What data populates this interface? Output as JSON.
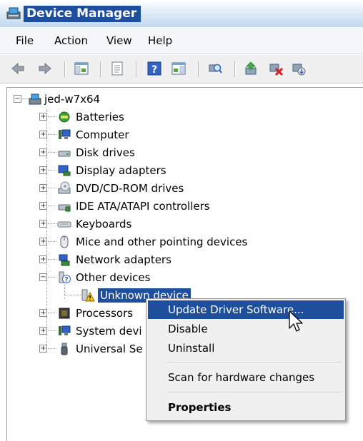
{
  "window": {
    "title": "Device Manager"
  },
  "menu": [
    "File",
    "Action",
    "View",
    "Help"
  ],
  "toolbar": {
    "icons": [
      "back-icon",
      "forward-icon",
      "show-hide-console-tree-icon",
      "properties-icon",
      "help-icon",
      "action-pane-icon",
      "scan-hardware-icon",
      "update-driver-icon",
      "uninstall-icon",
      "disable-icon"
    ]
  },
  "tree": {
    "root": "jed-w7x64",
    "categories": [
      {
        "label": "Batteries",
        "icon": "battery-icon"
      },
      {
        "label": "Computer",
        "icon": "computer-icon"
      },
      {
        "label": "Disk drives",
        "icon": "disk-drive-icon"
      },
      {
        "label": "Display adapters",
        "icon": "display-adapter-icon"
      },
      {
        "label": "DVD/CD-ROM drives",
        "icon": "dvd-drive-icon"
      },
      {
        "label": "IDE ATA/ATAPI controllers",
        "icon": "ide-controller-icon"
      },
      {
        "label": "Keyboards",
        "icon": "keyboard-icon"
      },
      {
        "label": "Mice and other pointing devices",
        "icon": "mouse-icon"
      },
      {
        "label": "Network adapters",
        "icon": "network-adapter-icon"
      },
      {
        "label": "Other devices",
        "icon": "other-devices-icon"
      }
    ],
    "other_child": "Unknown device",
    "after_categories": [
      {
        "label": "Processors",
        "icon": "processor-icon"
      },
      {
        "label": "System devi",
        "icon": "system-devices-icon"
      },
      {
        "label": "Universal Se",
        "icon": "usb-icon"
      }
    ]
  },
  "context_menu": {
    "items": [
      "Update Driver Software...",
      "Disable",
      "Uninstall",
      "Scan for hardware changes",
      "Properties"
    ]
  },
  "colors": {
    "selection": "#1e4f9e",
    "menu_bg": "#f0f0f0"
  }
}
